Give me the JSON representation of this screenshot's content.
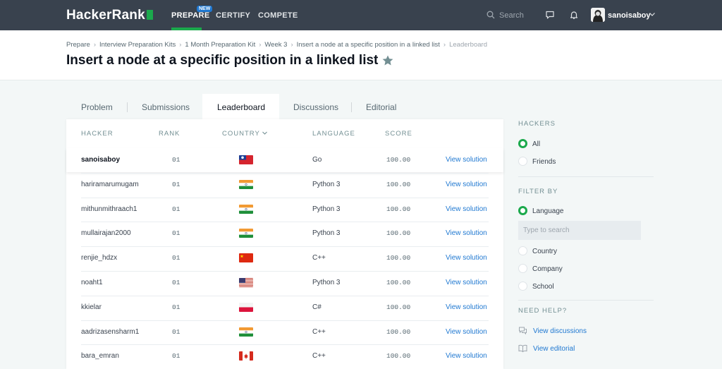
{
  "nav": {
    "logo": "HackerRank",
    "items": [
      {
        "label": "PREPARE",
        "active": true
      },
      {
        "label": "CERTIFY",
        "active": false
      },
      {
        "label": "COMPETE",
        "active": false
      }
    ],
    "new_badge": "NEW",
    "search_placeholder": "Search",
    "username": "sanoisaboy"
  },
  "header": {
    "breadcrumbs": [
      "Prepare",
      "Interview Preparation Kits",
      "1 Month Preparation Kit",
      "Week 3",
      "Insert a node at a specific position in a linked list",
      "Leaderboard"
    ],
    "title": "Insert a node at a specific position in a linked list"
  },
  "tabs": [
    "Problem",
    "Submissions",
    "Leaderboard",
    "Discussions",
    "Editorial"
  ],
  "active_tab": "Leaderboard",
  "leaderboard": {
    "columns": {
      "hacker": "HACKER",
      "rank": "RANK",
      "country": "COUNTRY",
      "language": "LANGUAGE",
      "score": "SCORE"
    },
    "rows": [
      {
        "hacker": "sanoisaboy",
        "rank": "01",
        "flag": "taiwan",
        "language": "Go",
        "score": "100.00",
        "action": "View solution"
      },
      {
        "hacker": "hariramarumugam",
        "rank": "01",
        "flag": "india",
        "language": "Python 3",
        "score": "100.00",
        "action": "View solution"
      },
      {
        "hacker": "mithunmithraach1",
        "rank": "01",
        "flag": "india",
        "language": "Python 3",
        "score": "100.00",
        "action": "View solution"
      },
      {
        "hacker": "mullairajan2000",
        "rank": "01",
        "flag": "india",
        "language": "Python 3",
        "score": "100.00",
        "action": "View solution"
      },
      {
        "hacker": "renjie_hdzx",
        "rank": "01",
        "flag": "china",
        "language": "C++",
        "score": "100.00",
        "action": "View solution"
      },
      {
        "hacker": "noaht1",
        "rank": "01",
        "flag": "usa",
        "language": "Python 3",
        "score": "100.00",
        "action": "View solution"
      },
      {
        "hacker": "kkielar",
        "rank": "01",
        "flag": "poland",
        "language": "C#",
        "score": "100.00",
        "action": "View solution"
      },
      {
        "hacker": "aadrizasensharm1",
        "rank": "01",
        "flag": "india",
        "language": "C++",
        "score": "100.00",
        "action": "View solution"
      },
      {
        "hacker": "bara_emran",
        "rank": "01",
        "flag": "canada",
        "language": "C++",
        "score": "100.00",
        "action": "View solution"
      }
    ]
  },
  "sidebar": {
    "hackers_heading": "HACKERS",
    "hackers_options": [
      {
        "label": "All",
        "selected": true
      },
      {
        "label": "Friends",
        "selected": false
      }
    ],
    "filter_heading": "FILTER BY",
    "filter_options": [
      {
        "label": "Language",
        "selected": true
      },
      {
        "label": "Country",
        "selected": false
      },
      {
        "label": "Company",
        "selected": false
      },
      {
        "label": "School",
        "selected": false
      }
    ],
    "filter_placeholder": "Type to search",
    "help_heading": "NEED HELP?",
    "help_links": [
      "View discussions",
      "View editorial"
    ]
  },
  "colors": {
    "nav_bg": "#39424e",
    "brand_green": "#1ba94c",
    "link_blue": "#1f78d1",
    "page_bg": "#f3f7f7"
  }
}
